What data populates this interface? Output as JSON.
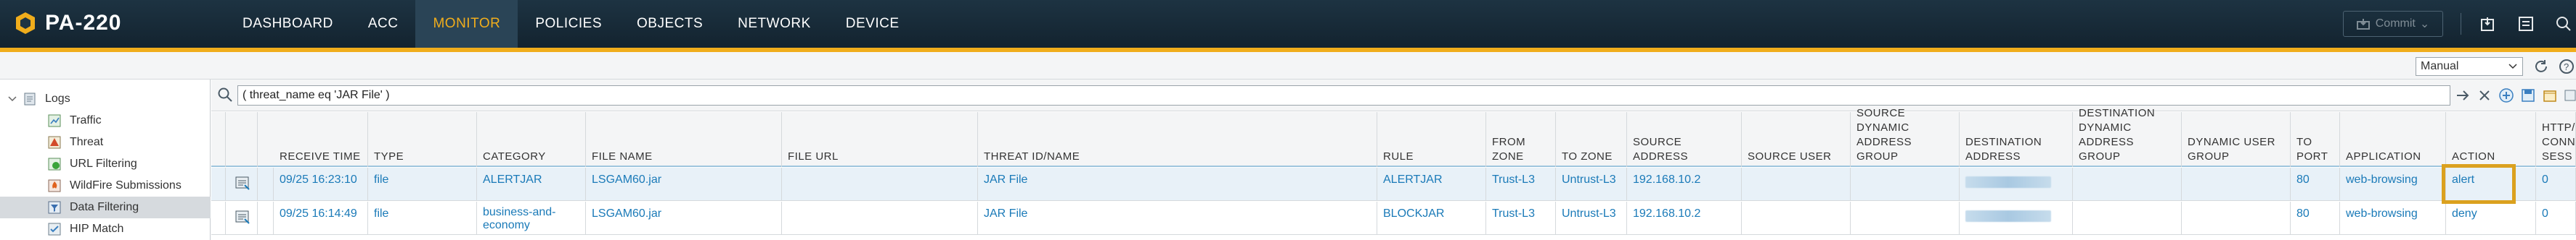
{
  "app": {
    "name": "PA-220"
  },
  "nav": {
    "tabs": [
      {
        "label": "DASHBOARD",
        "active": false
      },
      {
        "label": "ACC",
        "active": false
      },
      {
        "label": "MONITOR",
        "active": true
      },
      {
        "label": "POLICIES",
        "active": false
      },
      {
        "label": "OBJECTS",
        "active": false
      },
      {
        "label": "NETWORK",
        "active": false
      },
      {
        "label": "DEVICE",
        "active": false
      }
    ],
    "commit_label": "Commit"
  },
  "toolbar": {
    "refresh_mode": "Manual"
  },
  "sidebar": {
    "items": [
      {
        "label": "Logs",
        "icon": "logs-icon",
        "level": 0,
        "expanded": true
      },
      {
        "label": "Traffic",
        "icon": "traffic-icon",
        "level": 1
      },
      {
        "label": "Threat",
        "icon": "threat-icon",
        "level": 1
      },
      {
        "label": "URL Filtering",
        "icon": "url-filtering-icon",
        "level": 1
      },
      {
        "label": "WildFire Submissions",
        "icon": "wildfire-icon",
        "level": 1
      },
      {
        "label": "Data Filtering",
        "icon": "data-filtering-icon",
        "level": 1,
        "selected": true
      },
      {
        "label": "HIP Match",
        "icon": "hip-match-icon",
        "level": 1
      }
    ]
  },
  "filter": {
    "query": "( threat_name eq 'JAR File' )"
  },
  "table": {
    "columns": [
      "",
      "",
      "RECEIVE TIME",
      "TYPE",
      "CATEGORY",
      "FILE NAME",
      "FILE URL",
      "THREAT ID/NAME",
      "RULE",
      "FROM\nZONE",
      "TO ZONE",
      "SOURCE ADDRESS",
      "SOURCE USER",
      "SOURCE\nDYNAMIC\nADDRESS GROUP",
      "DESTINATION\nADDRESS",
      "DESTINATION\nDYNAMIC\nADDRESS GROUP",
      "DYNAMIC USER\nGROUP",
      "TO\nPORT",
      "APPLICATION",
      "ACTION",
      "HTTP/\nCONN\nSESS"
    ],
    "rows": [
      {
        "receive_time": "09/25 16:23:10",
        "type": "file",
        "category": "ALERTJAR",
        "file_name": "LSGAM60.jar",
        "file_url": "",
        "threat": "JAR File",
        "rule": "ALERTJAR",
        "from_zone": "Trust-L3",
        "to_zone": "Untrust-L3",
        "source_address": "192.168.10.2",
        "source_user": "",
        "src_dag": "",
        "dst_dag": "",
        "dyn_user_group": "",
        "to_port": "80",
        "application": "web-browsing",
        "action": "alert",
        "http_conn": "0"
      },
      {
        "receive_time": "09/25 16:14:49",
        "type": "file",
        "category": "business-and-\neconomy",
        "file_name": "LSGAM60.jar",
        "file_url": "",
        "threat": "JAR File",
        "rule": "BLOCKJAR",
        "from_zone": "Trust-L3",
        "to_zone": "Untrust-L3",
        "source_address": "192.168.10.2",
        "source_user": "",
        "src_dag": "",
        "dst_dag": "",
        "dyn_user_group": "",
        "to_port": "80",
        "application": "web-browsing",
        "action": "deny",
        "http_conn": "0"
      }
    ]
  },
  "colors": {
    "nav_bg": "#1d3342",
    "accent": "#f0ad1c",
    "link": "#1a7ab8",
    "selected_row": "#e8f1f8"
  }
}
